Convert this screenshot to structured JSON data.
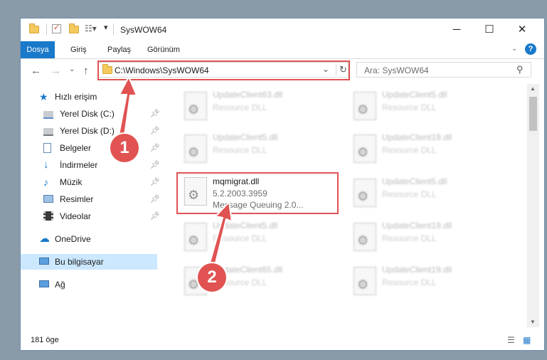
{
  "window": {
    "title": "SysWOW64"
  },
  "ribbon": {
    "tabs": [
      "Dosya",
      "Giriş",
      "Paylaş",
      "Görünüm"
    ]
  },
  "nav": {
    "address": "C:\\Windows\\SysWOW64",
    "search_placeholder": "Ara: SysWOW64"
  },
  "sidebar": {
    "quick_access": "Hızlı erişim",
    "items": [
      "Yerel Disk (C:)",
      "Yerel Disk (D:)",
      "Belgeler",
      "İndirmeler",
      "Müzik",
      "Resimler",
      "Videolar"
    ],
    "onedrive": "OneDrive",
    "this_pc": "Bu bilgisayar",
    "network": "Ağ"
  },
  "files": [
    {
      "name": "UpdateClient63.dll",
      "desc": "Resource DLL"
    },
    {
      "name": "UpdateClient5.dll",
      "desc": "Resource DLL"
    },
    {
      "name": "UpdateClient5.dll",
      "desc": "Resource DLL"
    },
    {
      "name": "UpdateClient19.dll",
      "desc": "Resource DLL"
    },
    {
      "name": "mqmigrat.dll",
      "version": "5.2.2003.3959",
      "desc": "Message Queuing 2.0..."
    },
    {
      "name": "UpdateClient5.dll",
      "desc": "Resource DLL"
    },
    {
      "name": "UpdateClient5.dll",
      "desc": "Resource DLL"
    },
    {
      "name": "UpdateClient19.dll",
      "desc": "Resource DLL"
    },
    {
      "name": "UpdateClient65.dll",
      "desc": "Resource DLL"
    },
    {
      "name": "UpdateClient19.dll",
      "desc": "Resource DLL"
    }
  ],
  "status": {
    "count": "181 öge"
  },
  "annotations": {
    "step1": "1",
    "step2": "2"
  },
  "colors": {
    "accent": "#1979ca",
    "highlight": "#e05352",
    "selected": "#cce8ff"
  }
}
